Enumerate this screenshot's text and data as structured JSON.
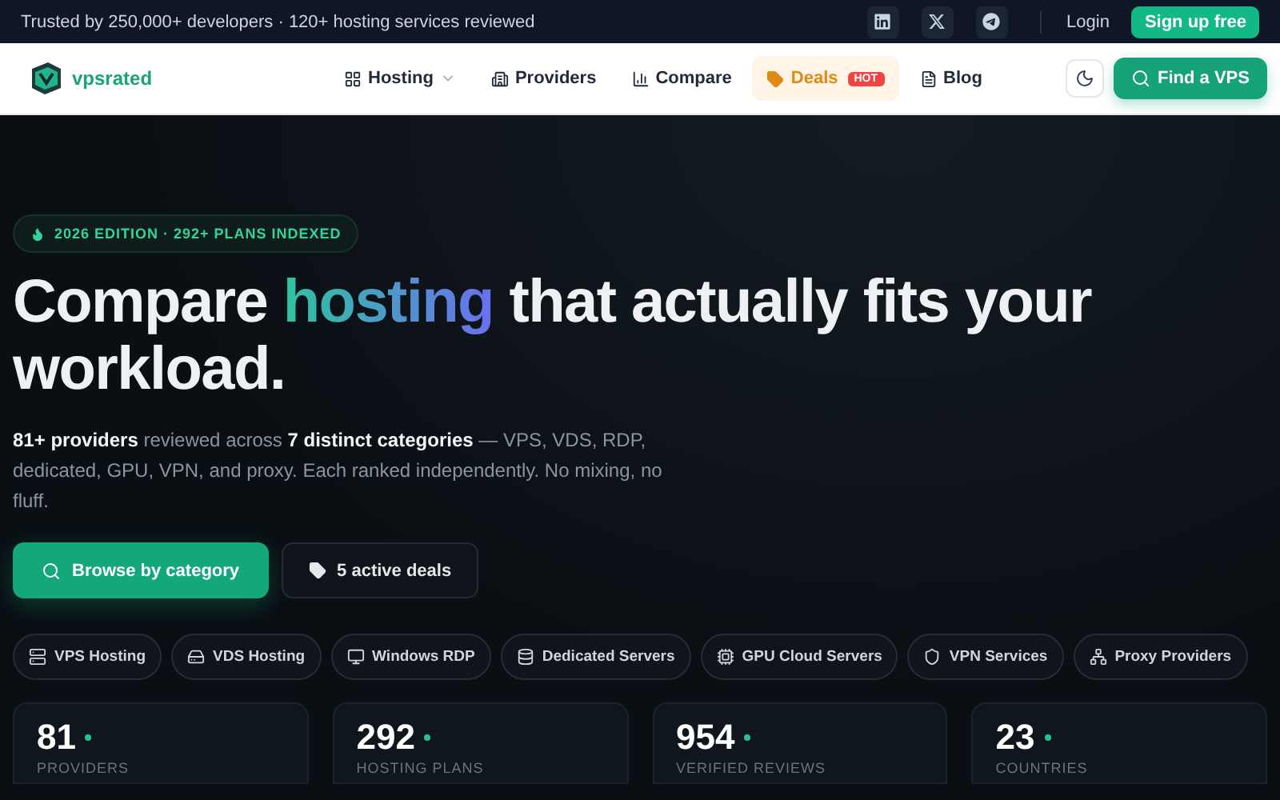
{
  "top_bar": {
    "tagline": "Trusted by 250,000+ developers · 120+ hosting services reviewed",
    "social": [
      {
        "kind": "linkedin"
      },
      {
        "kind": "x"
      },
      {
        "kind": "telegram"
      }
    ],
    "login": "Login",
    "signup": "Sign up free"
  },
  "nav": {
    "logo": "vpsrated",
    "items": [
      {
        "kind": "grid",
        "label": "Hosting",
        "dropdown": true,
        "highlighted": false
      },
      {
        "kind": "building",
        "label": "Providers",
        "dropdown": false,
        "highlighted": false
      },
      {
        "kind": "chart",
        "label": "Compare",
        "dropdown": false,
        "highlighted": false
      },
      {
        "kind": "tag",
        "label": "Deals",
        "badge": "HOT",
        "dropdown": false,
        "highlighted": true
      },
      {
        "kind": "doc",
        "label": "Blog",
        "dropdown": false,
        "highlighted": false
      }
    ],
    "cta": "Find a VPS"
  },
  "hero": {
    "badge": "2026 EDITION · 292+ PLANS INDEXED",
    "headline": [
      {
        "kind": "plain",
        "text": "Compare "
      },
      {
        "kind": "accent",
        "text": "hosting"
      },
      {
        "kind": "plain",
        "text": " that actually fits your workload."
      }
    ],
    "description": "**81+ providers** reviewed across **7 distinct categories** — VPS, VDS, RDP, dedicated, GPU, VPN, and proxy. Each ranked independently. No mixing, no fluff.",
    "primary_button": "Browse by category",
    "secondary_button": "5 active deals"
  },
  "categories": [
    {
      "kind": "vps",
      "label": "VPS Hosting"
    },
    {
      "kind": "vds",
      "label": "VDS Hosting"
    },
    {
      "kind": "rdp",
      "label": "Windows RDP"
    },
    {
      "kind": "dedicated",
      "label": "Dedicated Servers"
    },
    {
      "kind": "gpu",
      "label": "GPU Cloud Servers"
    },
    {
      "kind": "vpn",
      "label": "VPN Services"
    },
    {
      "kind": "proxy",
      "label": "Proxy Providers"
    }
  ],
  "stats": [
    {
      "value": "81",
      "label": "PROVIDERS"
    },
    {
      "value": "292",
      "label": "HOSTING PLANS"
    },
    {
      "value": "954",
      "label": "VERIFIED REVIEWS"
    },
    {
      "value": "23",
      "label": "COUNTRIES"
    }
  ]
}
